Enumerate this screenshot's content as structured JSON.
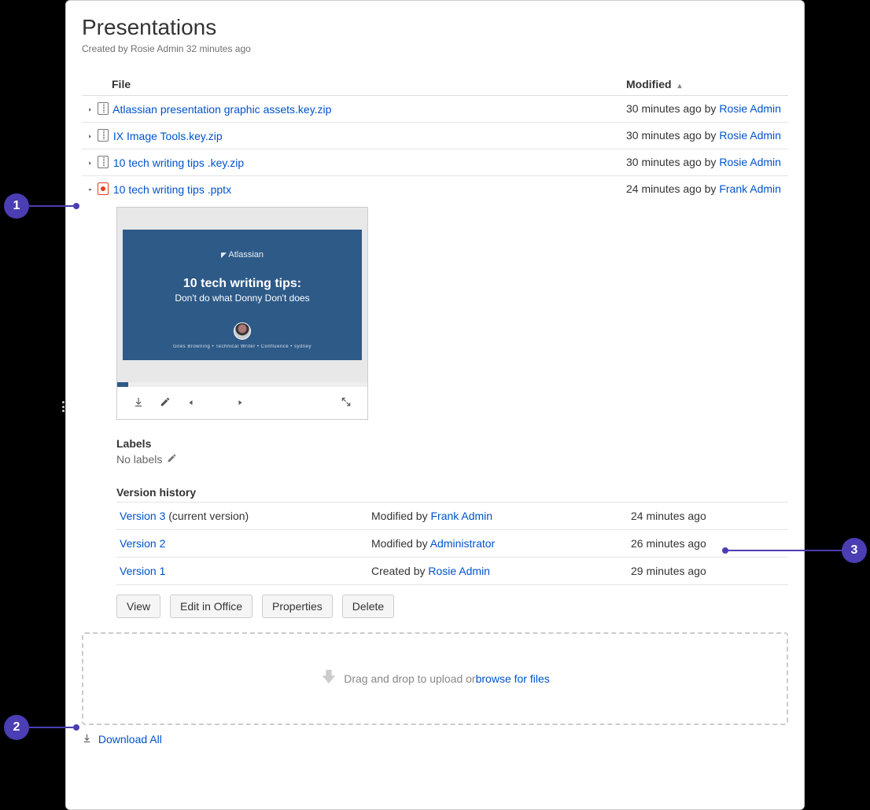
{
  "page": {
    "title": "Presentations",
    "created_by_prefix": "Created by ",
    "created_by": "Rosie Admin",
    "created_ago": " 32 minutes ago"
  },
  "table": {
    "col_file": "File",
    "col_modified": "Modified",
    "sort_indicator": "▴"
  },
  "files": [
    {
      "name": "Atlassian presentation graphic assets.key.zip",
      "type": "zip",
      "expanded": false,
      "modified_ago": "30 minutes ago",
      "by": "by ",
      "author": "Rosie Admin"
    },
    {
      "name": "IX Image Tools.key.zip",
      "type": "zip",
      "expanded": false,
      "modified_ago": "30 minutes ago",
      "by": "by ",
      "author": "Rosie Admin"
    },
    {
      "name": "10 tech writing tips .key.zip",
      "type": "zip",
      "expanded": false,
      "modified_ago": "30 minutes ago",
      "by": "by ",
      "author": "Rosie Admin"
    },
    {
      "name": "10 tech writing tips .pptx",
      "type": "pptx",
      "expanded": true,
      "modified_ago": "24 minutes ago",
      "by": "by ",
      "author": "Frank Admin"
    }
  ],
  "preview": {
    "logo_text": "Atlassian",
    "line1": "10 tech writing tips:",
    "line2": "Don't do what Donny Don't does",
    "subline": "Giles Browning  •  Technical Writer  •  Confluence  •  sydney"
  },
  "labels": {
    "heading": "Labels",
    "none": "No labels"
  },
  "version_history": {
    "heading": "Version history",
    "rows": [
      {
        "v": "Version 3",
        "suffix": " (current version)",
        "action_prefix": "Modified by ",
        "author": "Frank Admin",
        "ago": "24 minutes ago"
      },
      {
        "v": "Version 2",
        "suffix": "",
        "action_prefix": "Modified by ",
        "author": "Administrator",
        "ago": "26 minutes ago"
      },
      {
        "v": "Version 1",
        "suffix": "",
        "action_prefix": "Created by ",
        "author": "Rosie Admin",
        "ago": "29 minutes ago"
      }
    ]
  },
  "buttons": {
    "view": "View",
    "edit": "Edit in Office",
    "properties": "Properties",
    "delete": "Delete"
  },
  "dropzone": {
    "text": "Drag and drop to upload or ",
    "link": "browse for files"
  },
  "download_all": "Download All",
  "callouts": {
    "c1": "1",
    "c2": "2",
    "c3": "3"
  }
}
